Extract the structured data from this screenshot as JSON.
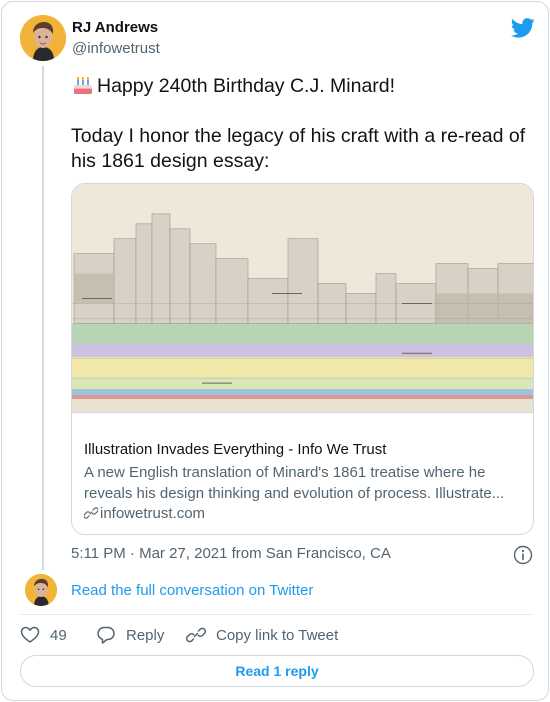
{
  "author": {
    "name": "RJ Andrews",
    "handle": "@infowetrust"
  },
  "tweet": {
    "line1": "Happy 240th Birthday C.J. Minard!",
    "line2": "Today I honor the legacy of his craft with a re-read of",
    "line3": "his 1861 design essay:",
    "emoji_icon": "birthday-cake-icon"
  },
  "link_card": {
    "title": "Illustration Invades Everything - Info We Trust",
    "description_line1": "A new English translation of Minard's 1861 treatise where he",
    "description_line2": "reveals his design thinking and evolution of process. Illustrate...",
    "domain": "infowetrust.com"
  },
  "meta": {
    "timestamp": "5:11 PM · Mar 27, 2021 from San Francisco, CA"
  },
  "conversation": {
    "label": "Read the full conversation on Twitter"
  },
  "actions": {
    "like_count": "49",
    "reply_label": "Reply",
    "copy_label": "Copy link to Tweet"
  },
  "read_reply": {
    "label": "Read 1 reply"
  },
  "colors": {
    "accent": "#1d9bf0",
    "text": "#0f1419",
    "secondary": "#536471",
    "border": "#cfd9de",
    "avatar_bg": "#f2b438"
  }
}
